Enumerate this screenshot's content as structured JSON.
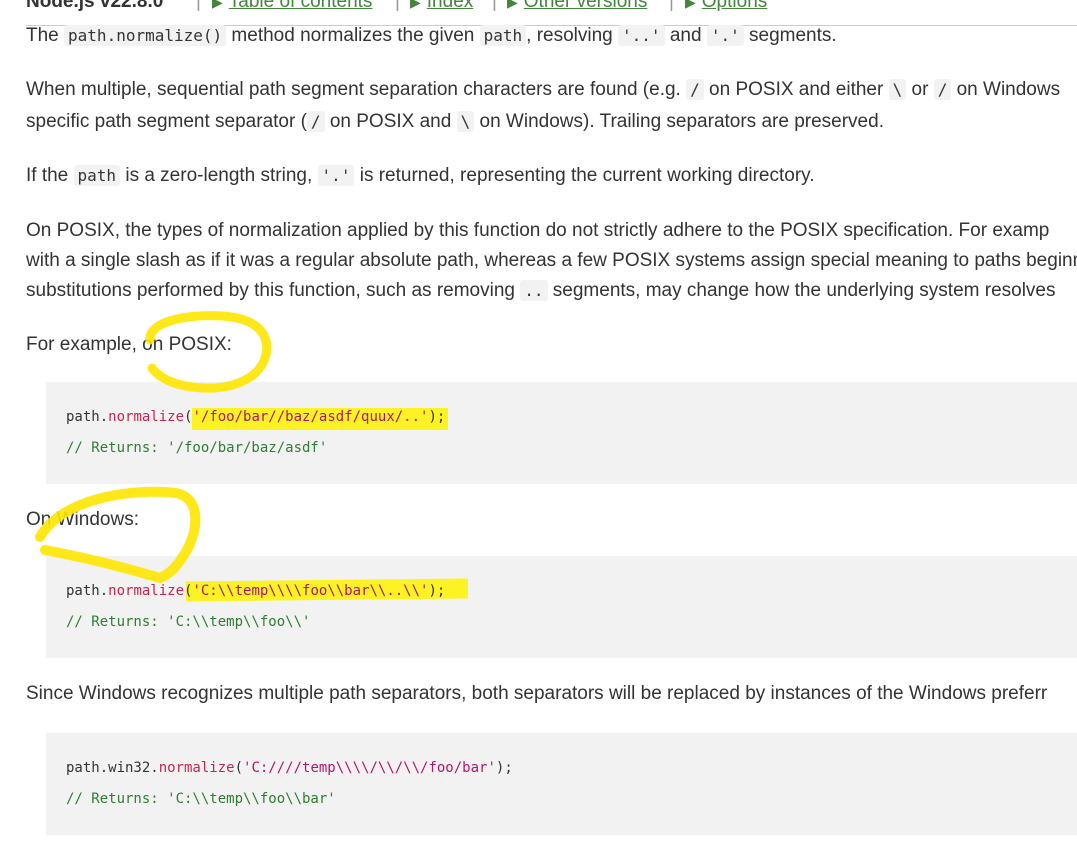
{
  "header": {
    "title": "Node.js v22.8.0",
    "nav": [
      "Table of contents",
      "Index",
      "Other versions",
      "Options"
    ]
  },
  "p1": {
    "a": "The ",
    "code1": "path.normalize()",
    "b": " method normalizes the given ",
    "code2": "path",
    "c": ", resolving ",
    "code3": "'..'",
    "d": " and ",
    "code4": "'.'",
    "e": " segments."
  },
  "p2": {
    "l1a": "When multiple, sequential path segment separation characters are found (e.g. ",
    "l1c1": "/",
    "l1b": " on POSIX and either ",
    "l1c2": "\\",
    "l1c": " or ",
    "l1c3": "/",
    "l1d": " on Windows",
    "l2a": "specific path segment separator (",
    "l2c1": "/",
    "l2b": " on POSIX and ",
    "l2c2": "\\",
    "l2c": " on Windows). Trailing separators are preserved."
  },
  "p3": {
    "a": "If the ",
    "code1": "path",
    "b": " is a zero-length string, ",
    "code2": "'.'",
    "c": " is returned, representing the current working directory."
  },
  "p4": {
    "l1": "On POSIX, the types of normalization applied by this function do not strictly adhere to the POSIX specification. For examp",
    "l2": "with a single slash as if it was a regular absolute path, whereas a few POSIX systems assign special meaning to paths beginn",
    "l3a": "substitutions performed by this function, such as removing ",
    "l3code": "..",
    "l3b": " segments, may change how the underlying system resolves"
  },
  "p5": "For example, on POSIX:",
  "code_posix": {
    "obj": "path.",
    "fn": "normalize",
    "open": "(",
    "str": "'/foo/bar//baz/asdf/quux/..'",
    "close": ");",
    "comment": "// Returns: '/foo/bar/baz/asdf'"
  },
  "p6": "On Windows:",
  "code_windows": {
    "obj": "path.",
    "fn": "normalize",
    "open": "(",
    "str": "'C:\\\\temp\\\\\\\\foo\\\\bar\\\\..\\\\'",
    "close": ");",
    "comment": "// Returns: 'C:\\\\temp\\\\foo\\\\'"
  },
  "p7": "Since Windows recognizes multiple path separators, both separators will be replaced by instances of the Windows preferr",
  "code_win32": {
    "obj": "path.win32.",
    "fn": "normalize",
    "open": "(",
    "str": "'C:////temp\\\\\\\\/\\\\/\\\\/foo/bar'",
    "close": ");",
    "comment": "// Returns: 'C:\\\\temp\\\\foo\\\\bar'"
  },
  "colors": {
    "link_green": "#43853d",
    "highlighter": "#fff200",
    "code_bg": "#f2f2f2"
  }
}
